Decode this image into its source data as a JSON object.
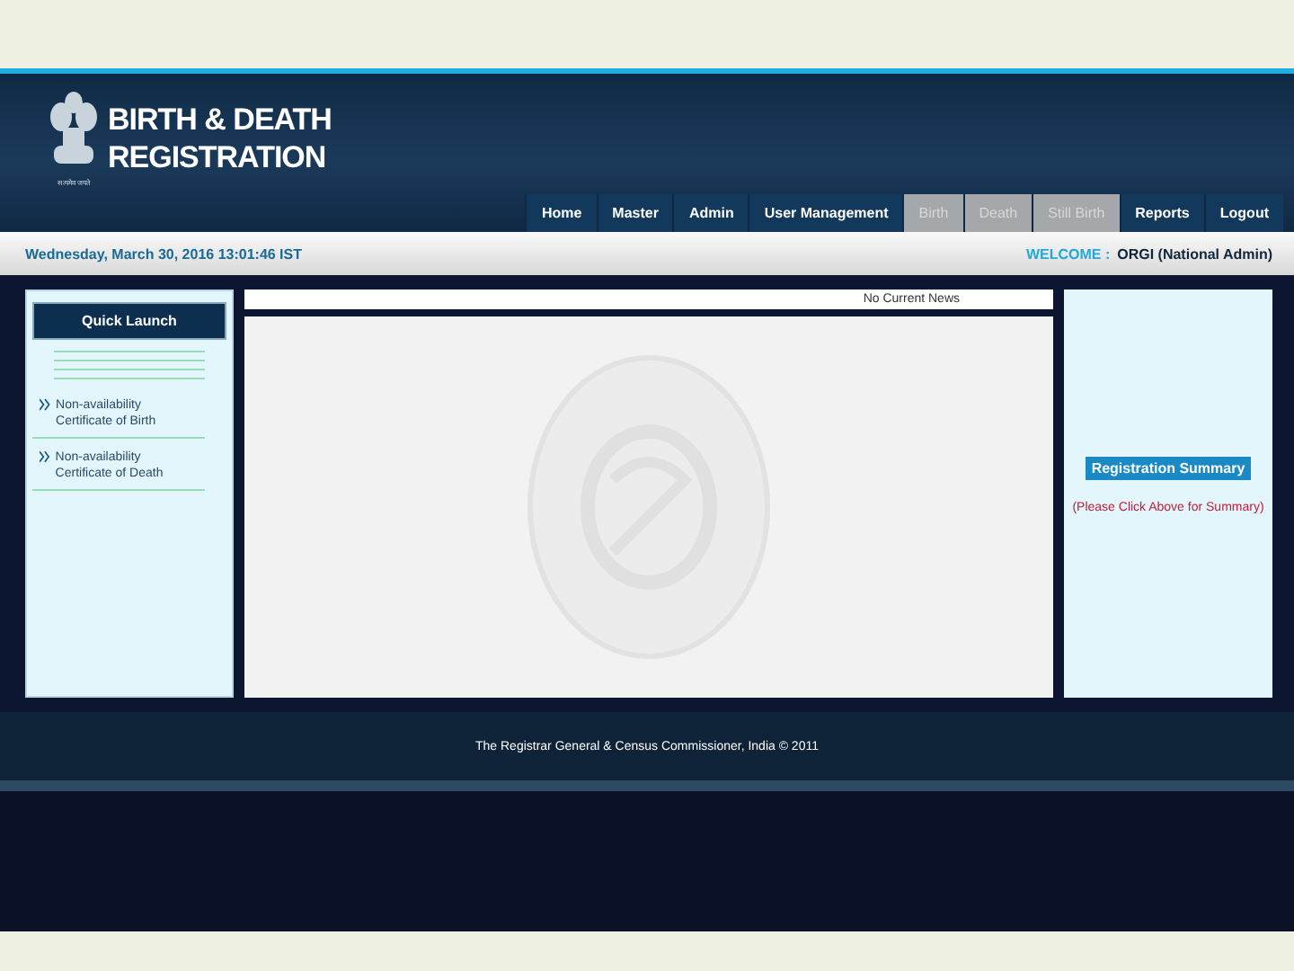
{
  "header": {
    "title_line_1": "BIRTH & DEATH",
    "title_line_2": "REGISTRATION",
    "emblem_caption": "सत्यमेव जयते"
  },
  "nav": [
    {
      "label": "Home",
      "disabled": false
    },
    {
      "label": "Master",
      "disabled": false
    },
    {
      "label": "Admin",
      "disabled": false
    },
    {
      "label": "User Management",
      "disabled": false
    },
    {
      "label": "Birth",
      "disabled": true
    },
    {
      "label": "Death",
      "disabled": true
    },
    {
      "label": "Still Birth",
      "disabled": true
    },
    {
      "label": "Reports",
      "disabled": false
    },
    {
      "label": "Logout",
      "disabled": false
    }
  ],
  "info_bar": {
    "datetime": "Wednesday, March 30, 2016 13:01:46 IST",
    "welcome_label": "WELCOME :",
    "user": "ORGI (National Admin)"
  },
  "quick_launch": {
    "title": "Quick Launch",
    "links": [
      "Non-availability Certificate of Birth",
      "Non-availability Certificate of Death"
    ]
  },
  "news": {
    "text": "No Current News"
  },
  "summary": {
    "button": "Registration Summary",
    "hint": "(Please Click Above for Summary)"
  },
  "footer": {
    "text": "The Registrar General & Census Commissioner, India © 2011"
  }
}
